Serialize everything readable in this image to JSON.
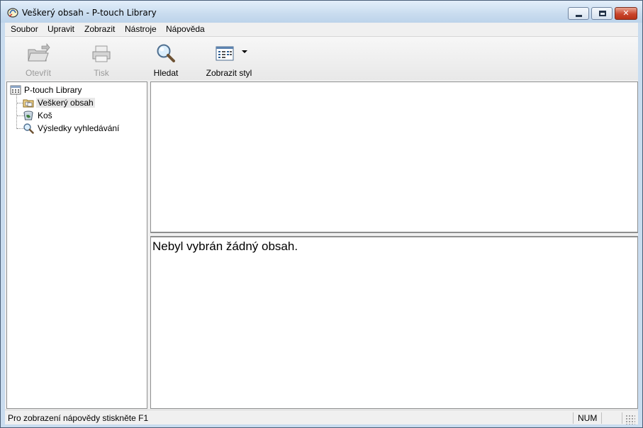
{
  "window": {
    "title": "Veškerý obsah - P-touch Library",
    "controls": {
      "minimize": "minimize",
      "maximize": "maximize",
      "close": "✕"
    }
  },
  "menu": [
    "Soubor",
    "Upravit",
    "Zobrazit",
    "Nástroje",
    "Nápověda"
  ],
  "toolbar": {
    "open_label": "Otevřít",
    "print_label": "Tisk",
    "search_label": "Hledat",
    "view_style_label": "Zobrazit styl",
    "icons": [
      "folder-open-icon",
      "printer-icon",
      "magnifier-icon",
      "view-style-icon"
    ]
  },
  "tree": {
    "root": "P-touch Library",
    "items": [
      "Veškerý obsah",
      "Koš",
      "Výsledky vyhledávání"
    ],
    "selected": "Veškerý obsah"
  },
  "detail": {
    "message": "Nebyl vybrán žádný obsah."
  },
  "statusbar": {
    "help": "Pro zobrazení nápovědy stiskněte F1",
    "num": "NUM"
  },
  "colors": {
    "frame": "#c9dcef",
    "close_button": "#c9452c",
    "pane_border": "#8e8f8f"
  }
}
